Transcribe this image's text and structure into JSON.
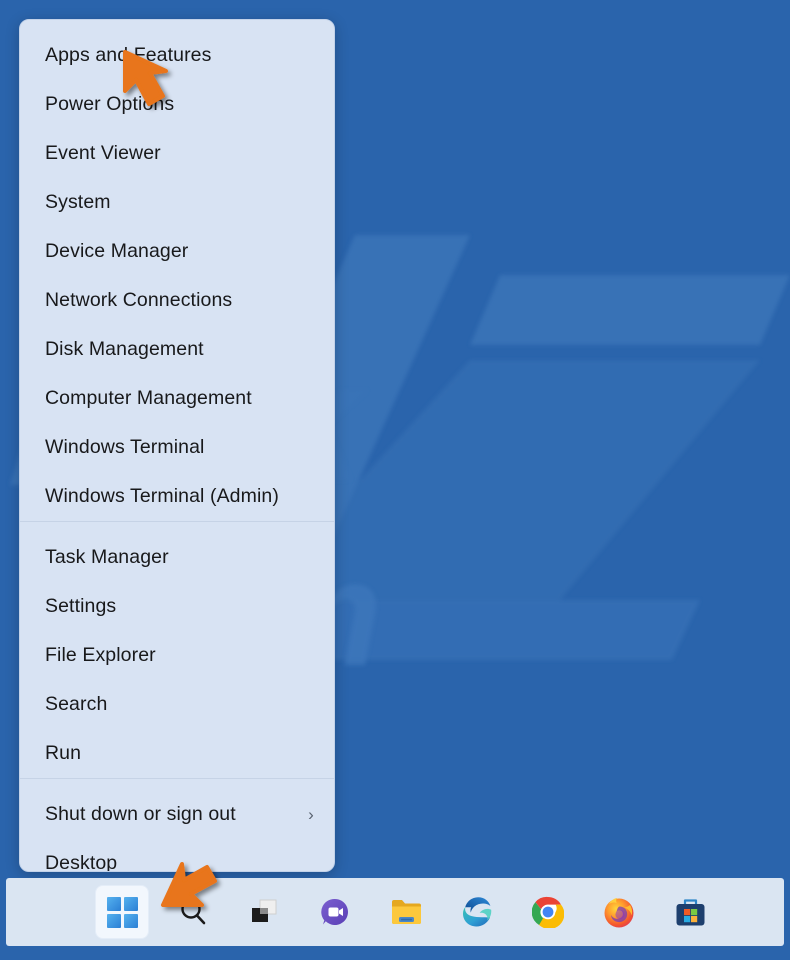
{
  "desktop": {
    "background_color": "#2a64ac",
    "watermark_text": "PCrisk.com"
  },
  "winx_menu": {
    "name": "Windows quick-link (Win+X) context menu",
    "background_color": "#d8e3f3",
    "groups": [
      {
        "items": [
          {
            "label": "Apps and Features",
            "has_submenu": false
          },
          {
            "label": "Power Options",
            "has_submenu": false
          },
          {
            "label": "Event Viewer",
            "has_submenu": false
          },
          {
            "label": "System",
            "has_submenu": false
          },
          {
            "label": "Device Manager",
            "has_submenu": false
          },
          {
            "label": "Network Connections",
            "has_submenu": false
          },
          {
            "label": "Disk Management",
            "has_submenu": false
          },
          {
            "label": "Computer Management",
            "has_submenu": false
          },
          {
            "label": "Windows Terminal",
            "has_submenu": false
          },
          {
            "label": "Windows Terminal (Admin)",
            "has_submenu": false
          }
        ]
      },
      {
        "items": [
          {
            "label": "Task Manager",
            "has_submenu": false
          },
          {
            "label": "Settings",
            "has_submenu": false
          },
          {
            "label": "File Explorer",
            "has_submenu": false
          },
          {
            "label": "Search",
            "has_submenu": false
          },
          {
            "label": "Run",
            "has_submenu": false
          }
        ]
      },
      {
        "items": [
          {
            "label": "Shut down or sign out",
            "has_submenu": true,
            "chevron": "›"
          },
          {
            "label": "Desktop",
            "has_submenu": false
          }
        ]
      }
    ]
  },
  "taskbar": {
    "background_color": "#dae5f2",
    "items": [
      {
        "icon": "windows-start-icon",
        "label": "Start",
        "active": true
      },
      {
        "icon": "search-icon",
        "label": "Search",
        "active": false
      },
      {
        "icon": "task-view-icon",
        "label": "Task View",
        "active": false
      },
      {
        "icon": "chat-icon",
        "label": "Chat",
        "active": false
      },
      {
        "icon": "file-explorer-icon",
        "label": "File Explorer",
        "active": false
      },
      {
        "icon": "microsoft-edge-icon",
        "label": "Microsoft Edge",
        "active": false
      },
      {
        "icon": "google-chrome-icon",
        "label": "Google Chrome",
        "active": false
      },
      {
        "icon": "mozilla-firefox-icon",
        "label": "Mozilla Firefox",
        "active": false
      },
      {
        "icon": "microsoft-store-icon",
        "label": "Microsoft Store",
        "active": false
      }
    ]
  },
  "annotations": {
    "color": "#e8751a",
    "pointers": [
      {
        "name": "cursor-arrow-apps-and-features",
        "direction": "up-left",
        "target": "Apps and Features"
      },
      {
        "name": "cursor-arrow-start-button",
        "direction": "down-left",
        "target": "Start"
      }
    ]
  }
}
